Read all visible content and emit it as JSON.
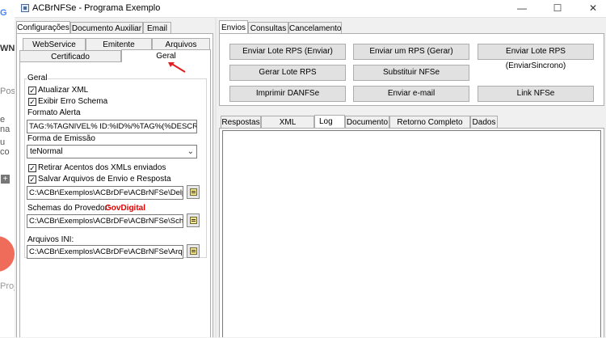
{
  "window": {
    "title": "ACBrNFSe - Programa Exemplo",
    "controls": [
      "—",
      "☐",
      "✕"
    ]
  },
  "background_window_fragments": [
    "G",
    "WN",
    "Post",
    "e na",
    "u co",
    "+",
    "Proj"
  ],
  "left": {
    "top_tabs": [
      "Configurações",
      "Documento Auxiliar",
      "Email"
    ],
    "sub_tabs_row1": [
      "WebService",
      "Emitente",
      "Arquivos"
    ],
    "sub_tabs_row2": [
      "Certificado",
      "Geral"
    ],
    "group_title": "Geral",
    "atualizar_xml": "Atualizar XML",
    "exibir_erro": "Exibir Erro Schema",
    "formato_alerta_label": "Formato Alerta",
    "formato_alerta_value": "TAG:%TAGNIVEL% ID:%ID%/%TAG%(%DESCRI",
    "forma_emissao_label": "Forma de Emissão",
    "forma_emissao_value": "teNormal",
    "retirar_acentos": "Retirar Acentos dos XMLs enviados",
    "salvar_arquivos": "Salvar Arquivos de Envio e Resposta",
    "path_arquivos": "C:\\ACBr\\Exemplos\\ACBrDFe\\ACBrNFSe\\Delphi",
    "schemas_label": "Schemas do Provedor:",
    "provedor_name": "GovDigital",
    "path_schemas": "C:\\ACBr\\Exemplos\\ACBrDFe\\ACBrNFSe\\Schem",
    "arquivos_ini_label": "Arquivos INI:",
    "path_ini": "C:\\ACBr\\Exemplos\\ACBrDFe\\ACBrNFSe\\ArqINI"
  },
  "right": {
    "top_tabs": [
      "Envios",
      "Consultas",
      "Cancelamento"
    ],
    "buttons": [
      "Enviar Lote RPS (Enviar)",
      "Enviar um RPS (Gerar)",
      "Enviar Lote RPS (EnviarSincrono)",
      "Gerar Lote RPS",
      "Substituir NFSe",
      "Imprimir DANFSe",
      "Enviar e-mail",
      "Link NFSe"
    ],
    "bottom_tabs": [
      "Respostas",
      "XML Resposta",
      "Log",
      "Documento",
      "Retorno Completo WS",
      "Dados"
    ]
  },
  "colors": {
    "provedor": "#e00000",
    "annotation_arrow": "#e02020"
  }
}
